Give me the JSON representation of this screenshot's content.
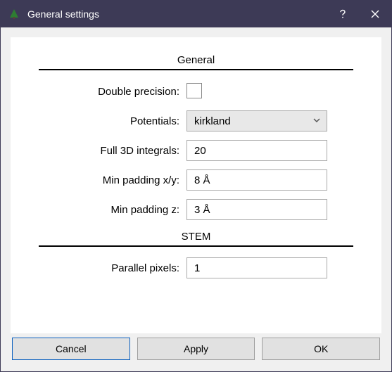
{
  "window": {
    "title": "General settings"
  },
  "sections": {
    "general": "General",
    "stem": "STEM"
  },
  "fields": {
    "double_precision": {
      "label": "Double precision:",
      "checked": false
    },
    "potentials": {
      "label": "Potentials:",
      "value": "kirkland"
    },
    "full3d": {
      "label": "Full 3D integrals:",
      "value": "20"
    },
    "min_pad_xy": {
      "label": "Min padding x/y:",
      "value": "8 Å"
    },
    "min_pad_z": {
      "label": "Min padding z:",
      "value": "3 Å"
    },
    "parallel_pixels": {
      "label": "Parallel pixels:",
      "value": "1"
    }
  },
  "buttons": {
    "cancel": "Cancel",
    "apply": "Apply",
    "ok": "OK"
  }
}
